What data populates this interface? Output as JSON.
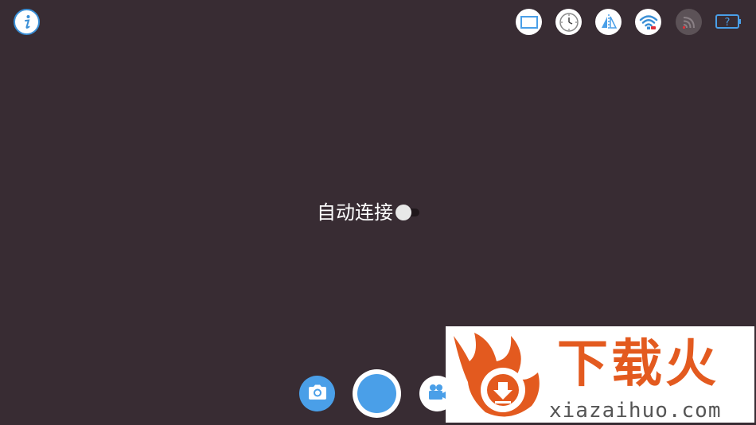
{
  "auto_connect": {
    "label": "自动连接",
    "enabled": false
  },
  "icons": {
    "info": "info-icon",
    "screen": "screen-icon",
    "timer": "clock-icon",
    "mirror": "mirror-icon",
    "wifi": "wifi-icon",
    "signal": "signal-icon",
    "battery": "battery-icon",
    "battery_text": "?",
    "photo": "camera-icon",
    "shutter": "shutter-icon",
    "video": "video-camera-icon"
  },
  "colors": {
    "background": "#382c33",
    "accent": "#4a9fe8",
    "watermark_orange": "#e35a1f"
  },
  "watermark": {
    "title": "下载火",
    "url": "xiazaihuo.com"
  }
}
